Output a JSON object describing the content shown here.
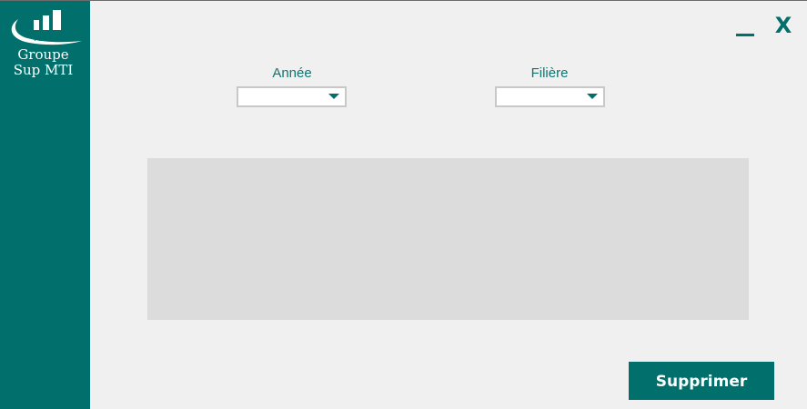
{
  "brand": {
    "logo_mark_text": "MTI",
    "line1": "Groupe",
    "line2": "Sup MTI"
  },
  "window_controls": {
    "minimize_icon": "minimize-icon",
    "close_label": "X"
  },
  "filters": {
    "annee": {
      "label": "Année",
      "value": ""
    },
    "filiere": {
      "label": "Filière",
      "value": ""
    }
  },
  "actions": {
    "delete_label": "Supprimer"
  },
  "colors": {
    "primary": "#016f6b",
    "background": "#f0f0f0",
    "grid_background": "#dcdcdc"
  }
}
